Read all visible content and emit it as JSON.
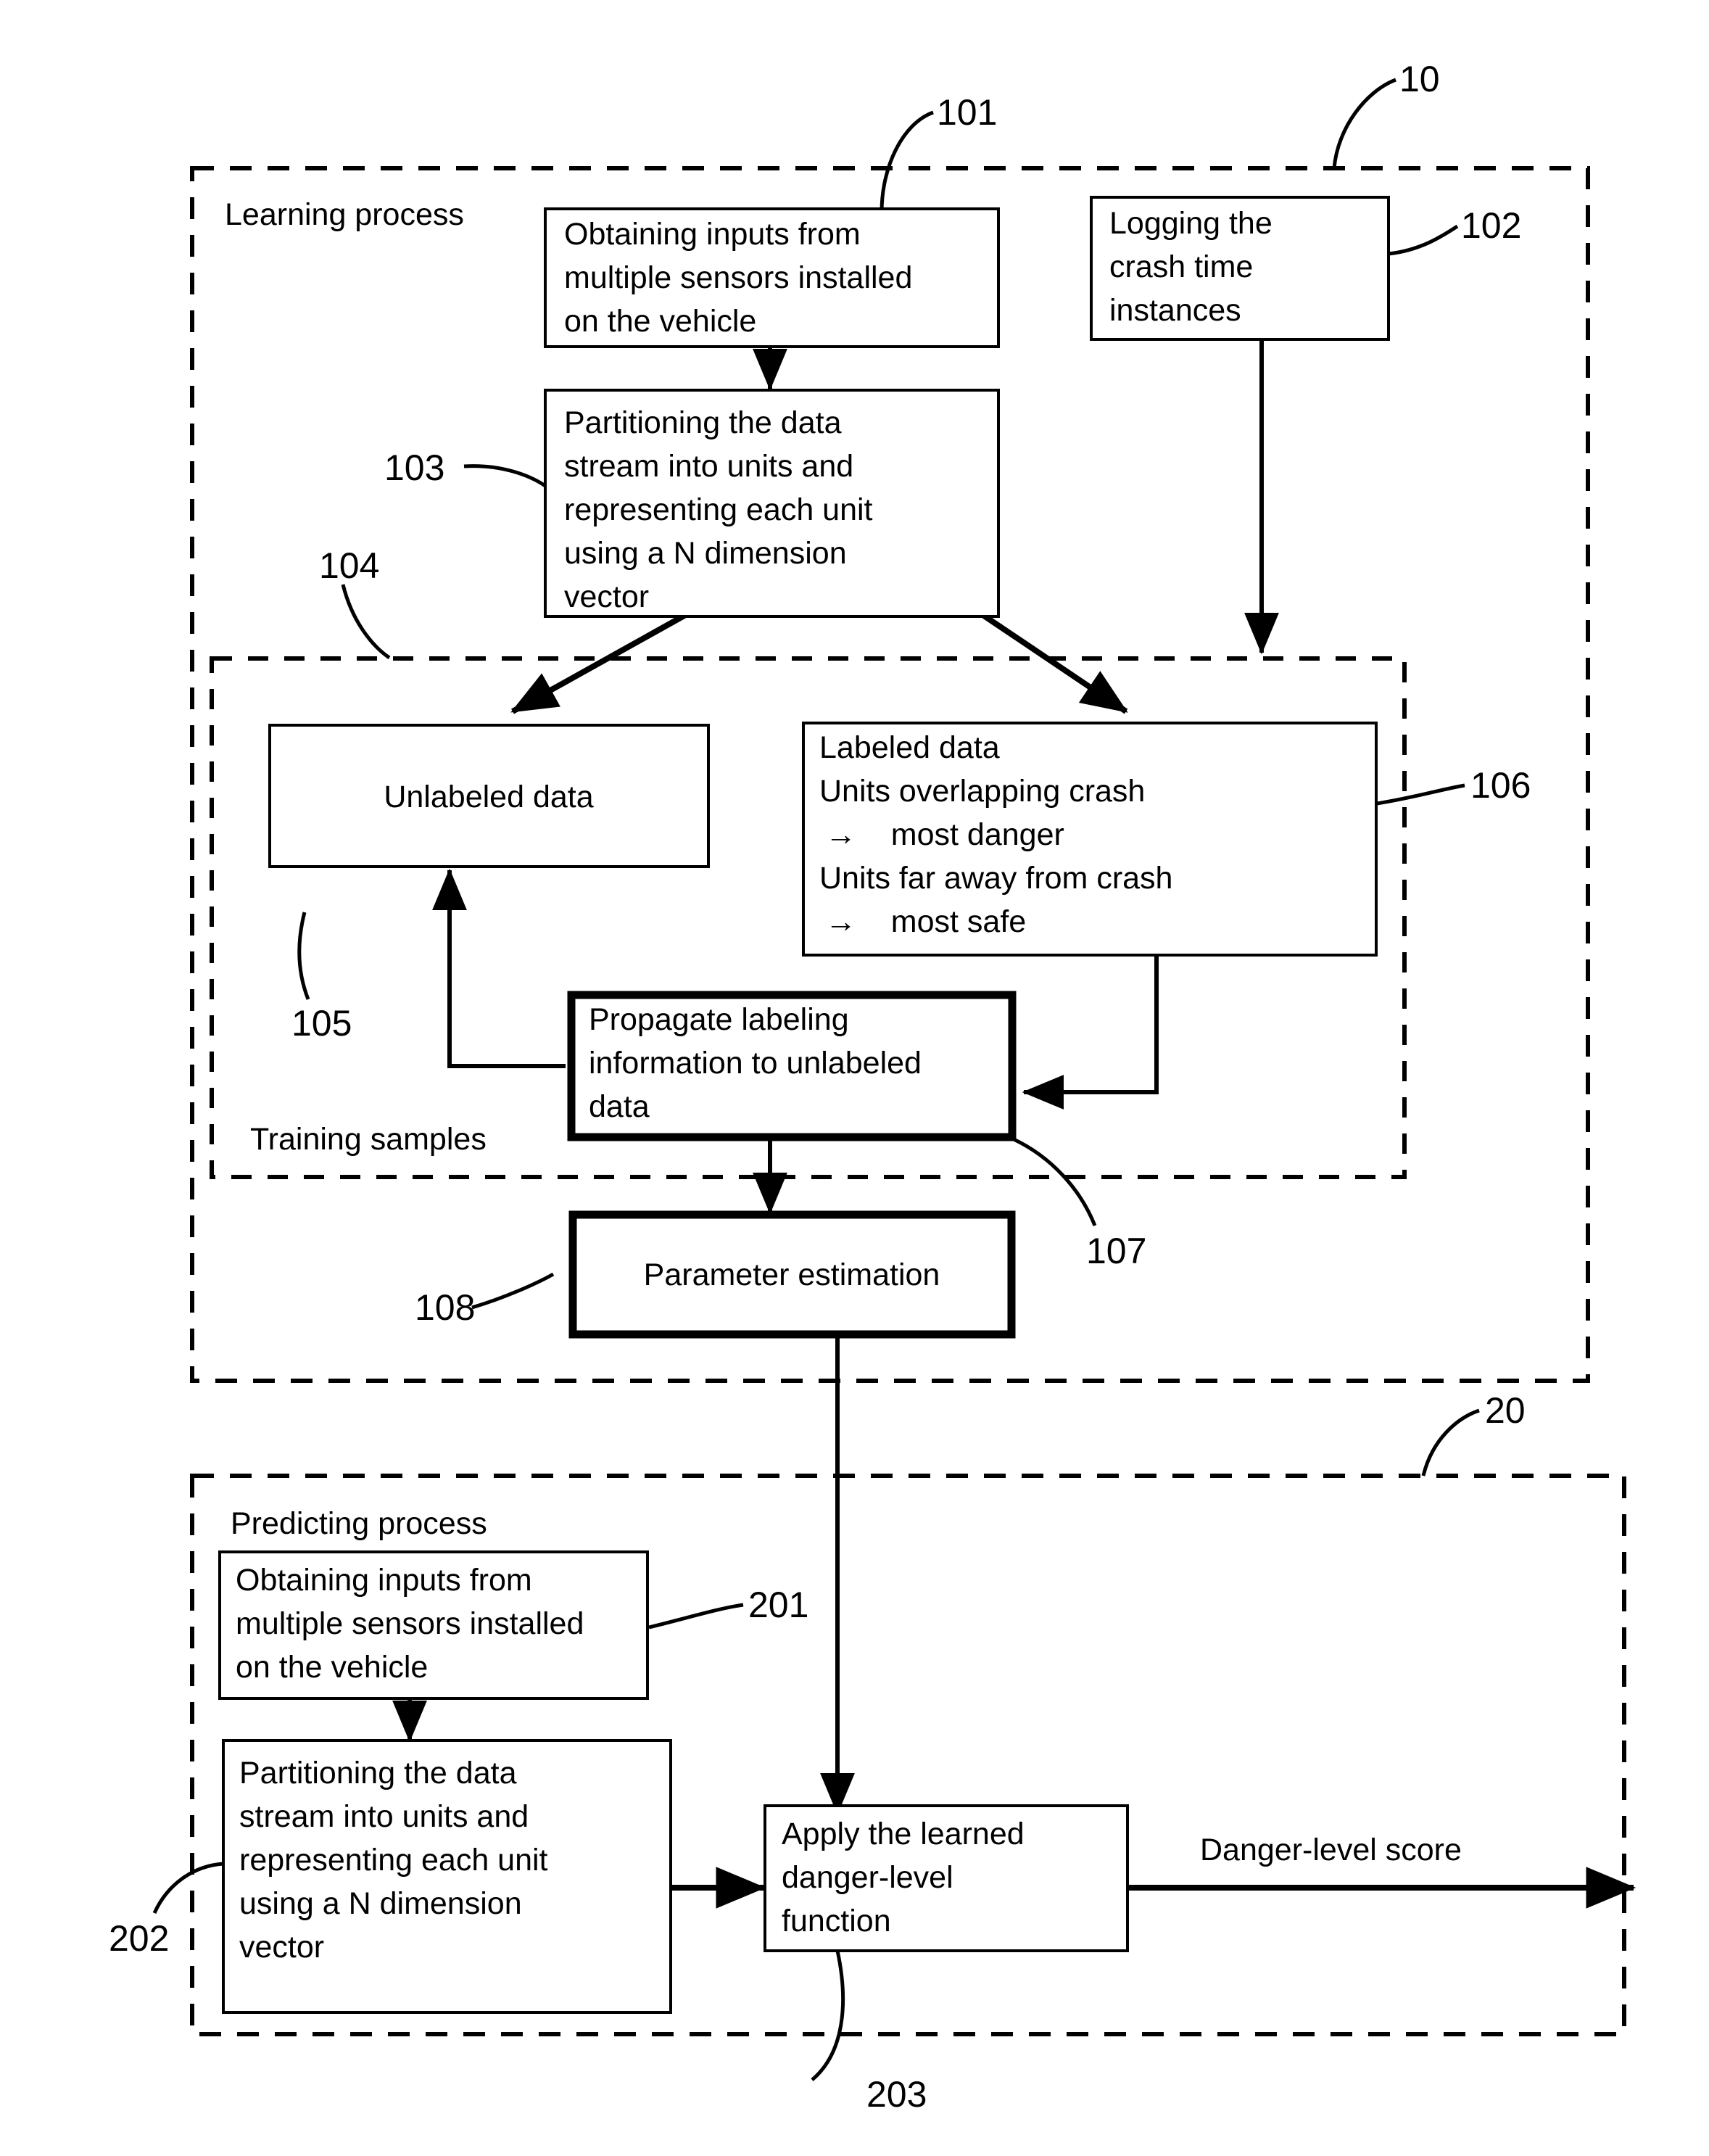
{
  "figure": {
    "type": "patent-flowchart",
    "background": "#ffffff",
    "line_color": "#000000"
  },
  "regions": {
    "learning": {
      "label": "Learning process",
      "ref": "10"
    },
    "training_samples": {
      "label": "Training samples",
      "ref": "104"
    },
    "predicting": {
      "label": "Predicting process",
      "ref": "20"
    }
  },
  "nodes": {
    "obtain_inputs_learning": {
      "ref": "101",
      "lines": [
        "Obtaining inputs from",
        "multiple sensors installed",
        "on the vehicle"
      ]
    },
    "logging_crash": {
      "ref": "102",
      "lines": [
        "Logging the",
        "crash time",
        "instances"
      ]
    },
    "partition_learning": {
      "ref": "103",
      "lines": [
        "Partitioning the data",
        "stream into units and",
        "representing each unit",
        "using a N dimension",
        "vector"
      ]
    },
    "unlabeled_data": {
      "ref": "105",
      "lines": [
        "Unlabeled data"
      ]
    },
    "labeled_data": {
      "ref": "106",
      "lines": [
        "Labeled data",
        "Units overlapping crash",
        "→    most danger",
        "Units far away from crash",
        "→    most safe"
      ]
    },
    "propagate_labeling": {
      "ref": "107",
      "lines": [
        "Propagate labeling",
        "information to unlabeled",
        "data"
      ]
    },
    "parameter_estimation": {
      "ref": "108",
      "lines": [
        "Parameter estimation"
      ]
    },
    "obtain_inputs_predicting": {
      "ref": "201",
      "lines": [
        "Obtaining inputs from",
        "multiple sensors installed",
        "on the vehicle"
      ]
    },
    "partition_predicting": {
      "ref": "202",
      "lines": [
        "Partitioning the data",
        "stream into units and",
        "representing each unit",
        "using a N dimension",
        "vector"
      ]
    },
    "apply_function": {
      "ref": "203",
      "lines": [
        "Apply the learned",
        "danger-level",
        "function"
      ]
    }
  },
  "edge_labels": {
    "output": "Danger-level score"
  }
}
